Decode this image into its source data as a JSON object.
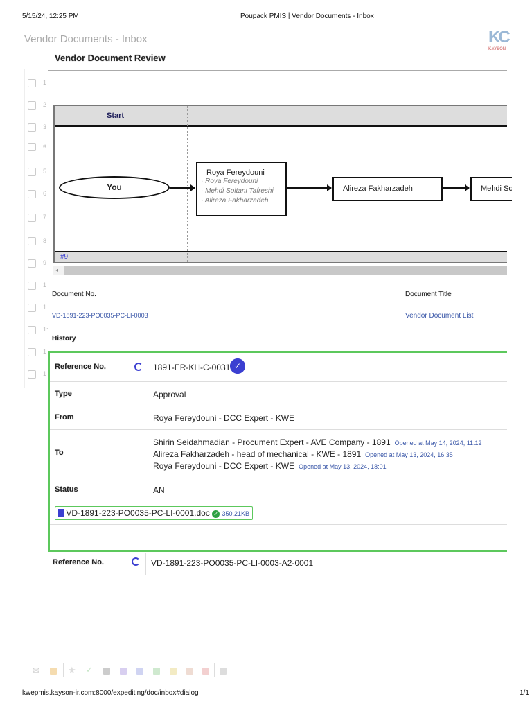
{
  "browser": {
    "datetime": "5/15/24, 12:25 PM",
    "title": "Poupack PMIS | Vendor Documents - Inbox",
    "url": "kwepmis.kayson-ir.com:8000/expediting/doc/inbox#dialog",
    "page": "1/1"
  },
  "page": {
    "title": "Vendor Documents - Inbox",
    "logo_text": "KAYSON",
    "dialog_title": "Vendor Document Review"
  },
  "list_rows": [
    "1",
    "2",
    "3",
    "#",
    "5",
    "6",
    "7",
    "8",
    "9",
    "1",
    "1",
    "1:",
    "1",
    "1"
  ],
  "workflow": {
    "header": "Start",
    "footer": "#9",
    "start_node": "You",
    "node1": {
      "title": "Roya Fereydouni",
      "members": [
        "Roya Fereydouni",
        "Mehdi Soltani Tafreshi",
        "Alireza Fakharzadeh"
      ]
    },
    "node2": "Alireza Fakharzadeh",
    "node3": "Mehdi So"
  },
  "document": {
    "no_label": "Document No.",
    "no_value": "VD-1891-223-PO0035-PC-LI-0003",
    "title_label": "Document Title",
    "title_value": "Vendor Document List",
    "history_label": "History"
  },
  "history": {
    "ref_label": "Reference No.",
    "ref_value": "1891-ER-KH-C-0031",
    "type_label": "Type",
    "type_value": "Approval",
    "from_label": "From",
    "from_value": "Roya Fereydouni - DCC Expert - KWE",
    "to_label": "To",
    "to": [
      {
        "name": "Shirin Seidahmadian - Procument Expert - AVE Company - 1891",
        "opened": "Opened at May 14, 2024, 11:12"
      },
      {
        "name": "Alireza Fakharzadeh - head of mechanical - KWE - 1891",
        "opened": "Opened at May 13, 2024, 16:35"
      },
      {
        "name": "Roya Fereydouni - DCC Expert - KWE",
        "opened": "Opened at May 13, 2024, 18:01"
      }
    ],
    "status_label": "Status",
    "status_value": "AN",
    "attachment": {
      "name": "VD-1891-223-PO0035-PC-LI-0001.doc",
      "size": "350.21KB"
    },
    "next_ref_label": "Reference No.",
    "next_ref_value": "VD-1891-223-PO0035-PC-LI-0003-A2-0001"
  },
  "colors": {
    "accent": "#3b3fd1",
    "green": "#5cc85c",
    "link": "#3a57a8"
  }
}
